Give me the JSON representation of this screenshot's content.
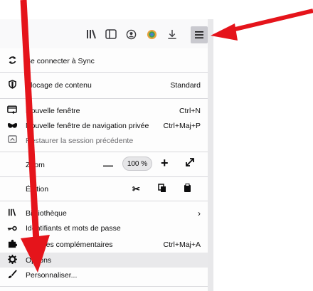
{
  "toolbar": {
    "icons": [
      "library-icon",
      "sidebar-icon",
      "account-icon",
      "extension-icon",
      "download-icon",
      "menu-icon"
    ]
  },
  "menu": {
    "sync": "Se connecter à Sync",
    "content_blocking": "Blocage de contenu",
    "content_blocking_value": "Standard",
    "new_window": "Nouvelle fenêtre",
    "new_window_sc": "Ctrl+N",
    "private_window": "Nouvelle fenêtre de navigation privée",
    "private_window_sc": "Ctrl+Maj+P",
    "restore_session": "Restaurer la session précédente",
    "zoom": "Zoom",
    "zoom_minus": "—",
    "zoom_value": "100 %",
    "zoom_plus": "+",
    "edit": "Édition",
    "library": "Bibliothèque",
    "logins": "Identifiants et mots de passe",
    "addons": "Modules complémentaires",
    "addons_sc": "Ctrl+Maj+A",
    "options": "Options",
    "customize": "Personnaliser..."
  },
  "colors": {
    "arrow": "#e5141b",
    "highlight": "#e9e9eb"
  }
}
